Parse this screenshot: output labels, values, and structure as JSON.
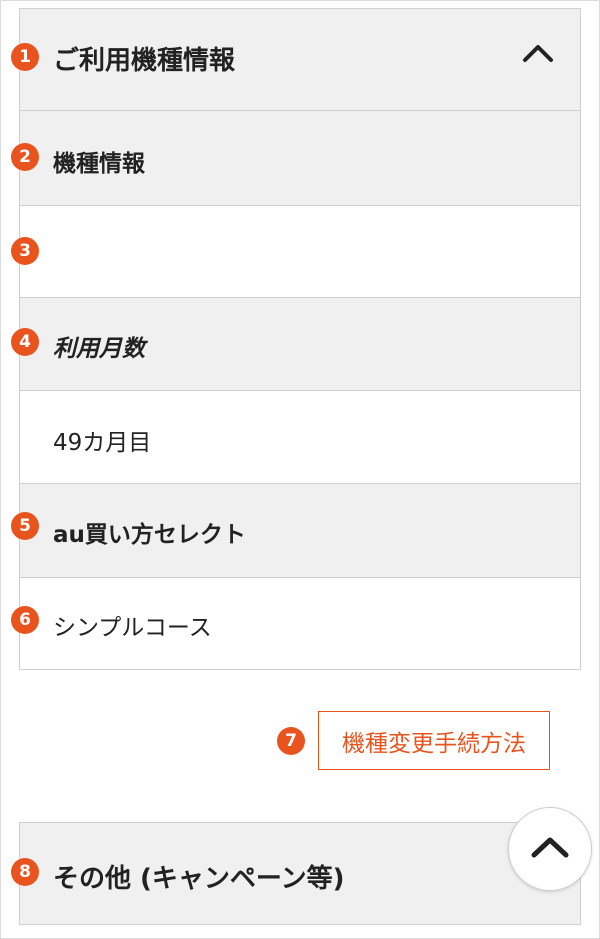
{
  "colors": {
    "accent": "#e9531d",
    "row_gray": "#f0f0f0",
    "border": "#cfcfcf"
  },
  "device_section": {
    "badge": "1",
    "title": "ご利用機種情報",
    "toggle_icon": "chevron-up-icon"
  },
  "rows": [
    {
      "badge": "2",
      "label": "機種情報"
    },
    {
      "badge": "3",
      "value": ""
    },
    {
      "badge": "4",
      "label": "利用月数"
    },
    {
      "badge": "",
      "value": "49カ月目"
    },
    {
      "badge": "5",
      "label": "au買い方セレクト"
    },
    {
      "badge": "6",
      "value": "シンプルコース"
    }
  ],
  "change_procedure": {
    "badge": "7",
    "label": "機種変更手続方法"
  },
  "other_section": {
    "badge": "8",
    "title": "その他 (キャンペーン等)"
  },
  "scroll_top": {
    "icon": "chevron-up-icon"
  }
}
